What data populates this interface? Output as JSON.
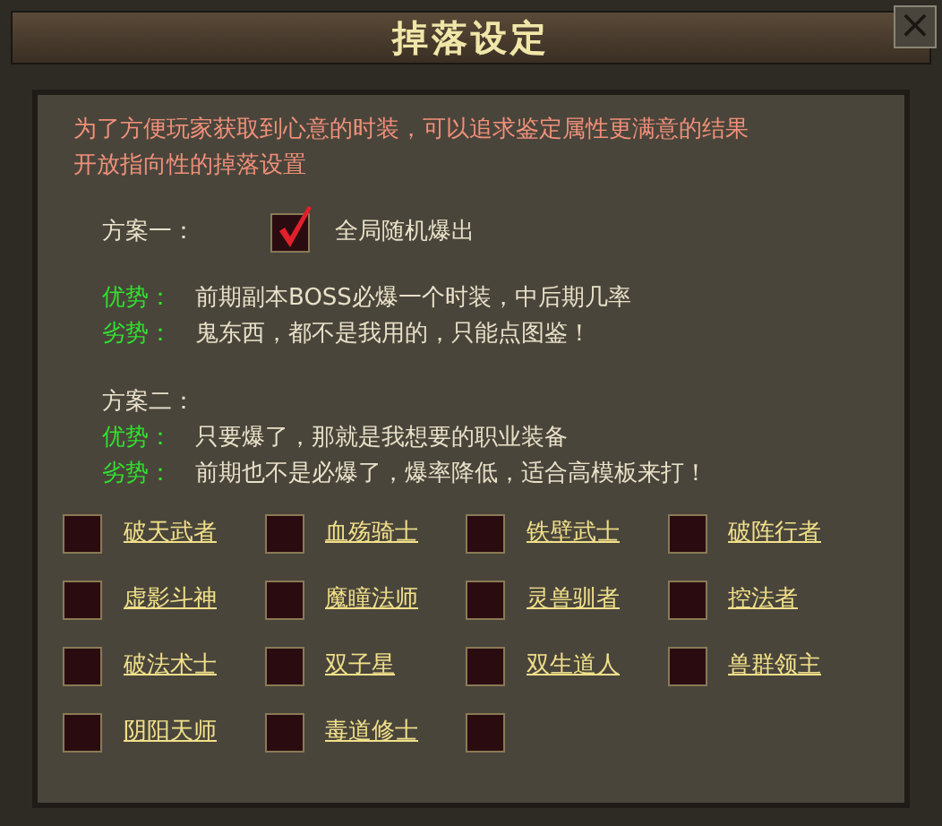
{
  "window": {
    "title": "掉落设定",
    "close": "×"
  },
  "intro": [
    "为了方便玩家获取到心意的时装，可以追求鉴定属性更满意的结果",
    "开放指向性的掉落设置"
  ],
  "plans": [
    {
      "title": "方案一：",
      "option": {
        "label": "全局随机爆出",
        "checked": true
      },
      "pros_label": "优势：",
      "pros": "前期副本BOSS必爆一个时装，中后期几率",
      "cons_label": "劣势：",
      "cons": "鬼东西，都不是我用的，只能点图鉴！"
    },
    {
      "title": "方案二：",
      "pros_label": "优势：",
      "pros": "只要爆了，那就是我想要的职业装备",
      "cons_label": "劣势：",
      "cons": "前期也不是必爆了，爆率降低，适合高模板来打！"
    }
  ],
  "classes": [
    {
      "label": "破天武者",
      "checked": false
    },
    {
      "label": "血殇骑士",
      "checked": false
    },
    {
      "label": "铁壁武士",
      "checked": false
    },
    {
      "label": "破阵行者",
      "checked": false
    },
    {
      "label": "虚影斗神",
      "checked": false
    },
    {
      "label": "魔瞳法师",
      "checked": false
    },
    {
      "label": "灵兽驯者",
      "checked": false
    },
    {
      "label": "控法者",
      "checked": false
    },
    {
      "label": "破法术士",
      "checked": false
    },
    {
      "label": "双子星",
      "checked": false
    },
    {
      "label": "双生道人",
      "checked": false
    },
    {
      "label": "兽群领主",
      "checked": false
    },
    {
      "label": "阴阳天师",
      "checked": false
    },
    {
      "label": "毒道修士",
      "checked": false
    },
    {
      "checked": false
    }
  ]
}
